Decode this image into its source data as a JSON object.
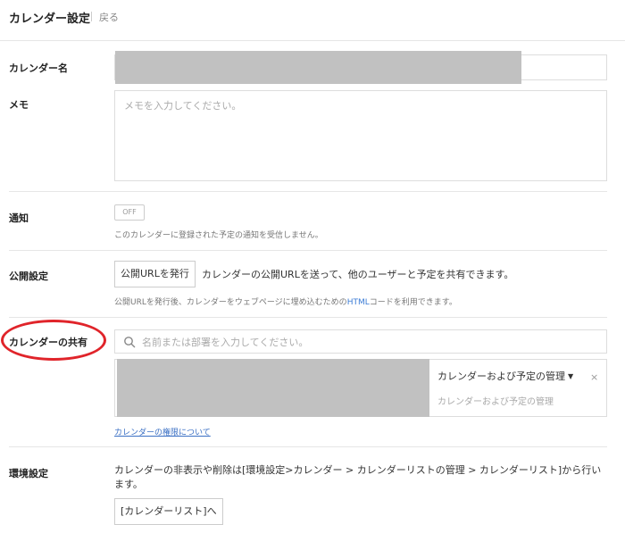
{
  "header": {
    "title": "カレンダー設定",
    "back_label": "戻る"
  },
  "calendar_name": {
    "label": "カレンダー名"
  },
  "memo": {
    "label": "メモ",
    "placeholder": "メモを入力してください。"
  },
  "notification": {
    "label": "通知",
    "toggle_label": "OFF",
    "toggle_state": false,
    "help": "このカレンダーに登録された予定の通知を受信しません。"
  },
  "publish": {
    "label": "公開設定",
    "button_label": "公開URLを発行",
    "description": "カレンダーの公開URLを送って、他のユーザーと予定を共有できます。",
    "help_before": "公開URLを発行後、カレンダーをウェブページに埋め込むための",
    "help_highlight": "HTML",
    "help_after": "コードを利用できます。"
  },
  "sharing": {
    "label": "カレンダーの共有",
    "search_placeholder": "名前または部署を入力してください。",
    "permission_selected": "カレンダーおよび予定の管理",
    "permission_description": "カレンダーおよび予定の管理",
    "remove_symbol": "×",
    "permissions_link": "カレンダーの権限について"
  },
  "environment": {
    "label": "環境設定",
    "description": "カレンダーの非表示や削除は[環境設定>カレンダー > カレンダーリストの管理 > カレンダーリスト]から行います。",
    "button_label": "[カレンダーリスト]へ"
  },
  "colors": {
    "annotation": "#e0242a",
    "link": "#3a6fc4",
    "redaction": "#c1c1c1"
  },
  "icons": {
    "search": "search-icon",
    "close": "close-icon",
    "caret": "caret-down-icon"
  }
}
